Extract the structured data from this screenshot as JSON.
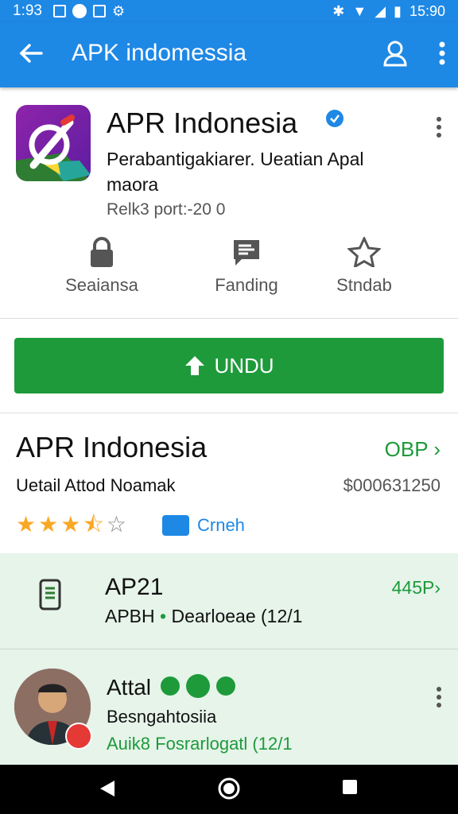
{
  "status_bar": {
    "time": "1:93",
    "clock": "15:90"
  },
  "app_bar": {
    "title": "APK indomessia"
  },
  "app": {
    "name": "APR Indonesia",
    "description": "Perabantigakiarer. Ueatian Apal maora",
    "meta": "Relk3 port:-20 0",
    "actions": [
      {
        "label": "Seaiansa",
        "icon": "lock-icon"
      },
      {
        "label": "Fanding",
        "icon": "chat-icon"
      },
      {
        "label": "Stndab",
        "icon": "star-outline-icon"
      }
    ],
    "install_label": "UNDU"
  },
  "detail": {
    "title": "APR Indonesia",
    "link": "OBP",
    "subtitle": "Uetail Attod Noamak",
    "price": "$000631250",
    "rating": 3.5,
    "chip_label": "Crneh"
  },
  "list": [
    {
      "title": "AP21",
      "subtitle_a": "APBH",
      "subtitle_b": "Dearloeae (12/1",
      "right": "445P"
    },
    {
      "title": "Attal",
      "subtitle": "Besngahtosiia",
      "green": "Auik8 Fosrarlogatl (12/1"
    }
  ],
  "colors": {
    "primary": "#1e88e5",
    "install": "#1e9a3b",
    "list_bg": "#e6f4ea",
    "star": "#f9a825"
  }
}
